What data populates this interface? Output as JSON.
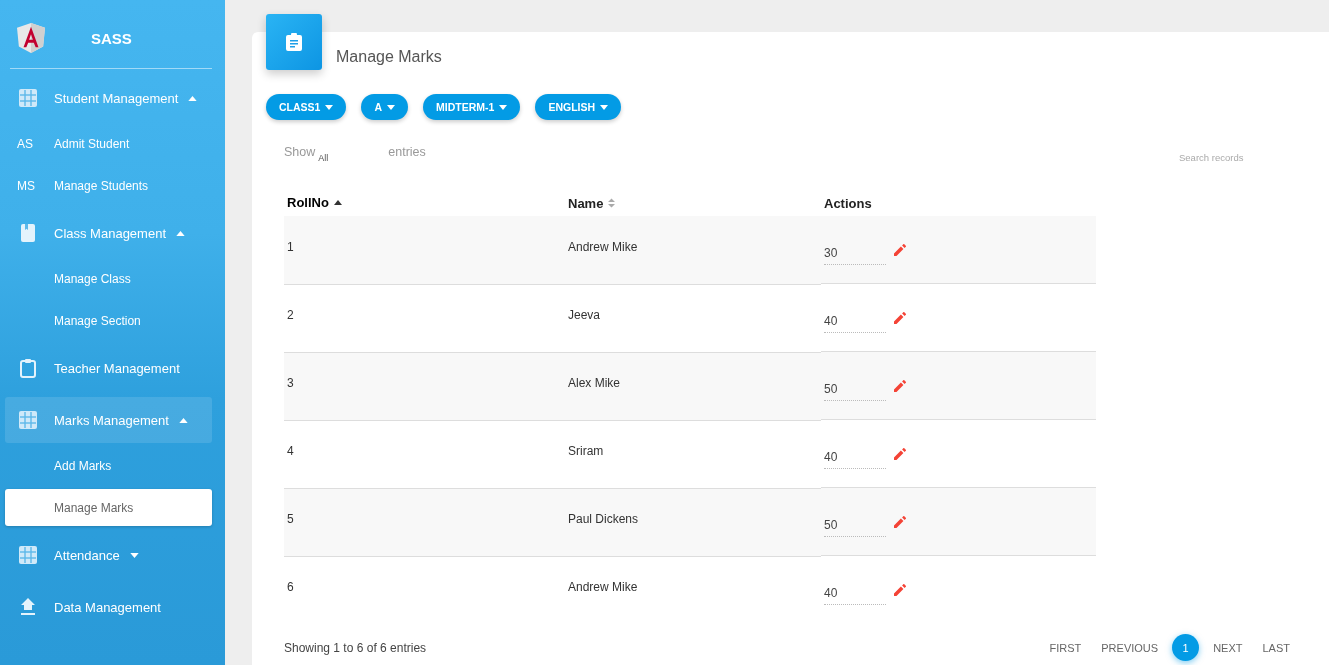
{
  "brand": {
    "title": "SASS"
  },
  "sidebar": {
    "items": [
      {
        "kind": "group",
        "label": "Student Management",
        "expanded": true,
        "selected": false,
        "children": [
          {
            "abbr": "AS",
            "label": "Admit Student",
            "selected": false
          },
          {
            "abbr": "MS",
            "label": "Manage Students",
            "selected": false
          }
        ]
      },
      {
        "kind": "group",
        "label": "Class Management",
        "expanded": true,
        "selected": false,
        "children": [
          {
            "label": "Manage Class",
            "selected": false
          },
          {
            "label": "Manage Section",
            "selected": false
          }
        ]
      },
      {
        "kind": "link",
        "label": "Teacher Management",
        "selected": false
      },
      {
        "kind": "group",
        "label": "Marks Management",
        "expanded": true,
        "selected": true,
        "children": [
          {
            "label": "Add Marks",
            "selected": false
          },
          {
            "label": "Manage Marks",
            "selected": true
          }
        ]
      },
      {
        "kind": "group",
        "label": "Attendance",
        "expanded": false,
        "selected": false
      },
      {
        "kind": "link",
        "label": "Data Management",
        "selected": false
      }
    ]
  },
  "page": {
    "title": "Manage Marks"
  },
  "filters": [
    "CLASS1",
    "A",
    "MIDTERM-1",
    "ENGLISH"
  ],
  "length": {
    "label": "Show",
    "value": "All",
    "suffix": "entries"
  },
  "search": {
    "placeholder": "Search records"
  },
  "table": {
    "columns": [
      {
        "label": "RollNo",
        "sortable": true,
        "sorted": true
      },
      {
        "label": "Name",
        "sortable": true,
        "sorted": false
      },
      {
        "label": "Actions",
        "sortable": false,
        "sorted": false
      }
    ],
    "rows": [
      {
        "roll": "1",
        "name": "Andrew Mike",
        "mark": "30"
      },
      {
        "roll": "2",
        "name": "Jeeva",
        "mark": "40"
      },
      {
        "roll": "3",
        "name": "Alex Mike",
        "mark": "50"
      },
      {
        "roll": "4",
        "name": "Sriram",
        "mark": "40"
      },
      {
        "roll": "5",
        "name": "Paul Dickens",
        "mark": "50"
      },
      {
        "roll": "6",
        "name": "Andrew Mike",
        "mark": "40"
      }
    ]
  },
  "info": "Showing 1 to 6 of 6 entries",
  "pagination": [
    {
      "label": "FIRST",
      "selected": false
    },
    {
      "label": "PREVIOUS",
      "selected": false
    },
    {
      "label": "1",
      "selected": true
    },
    {
      "label": "NEXT",
      "selected": false
    },
    {
      "label": "LAST",
      "selected": false
    }
  ]
}
